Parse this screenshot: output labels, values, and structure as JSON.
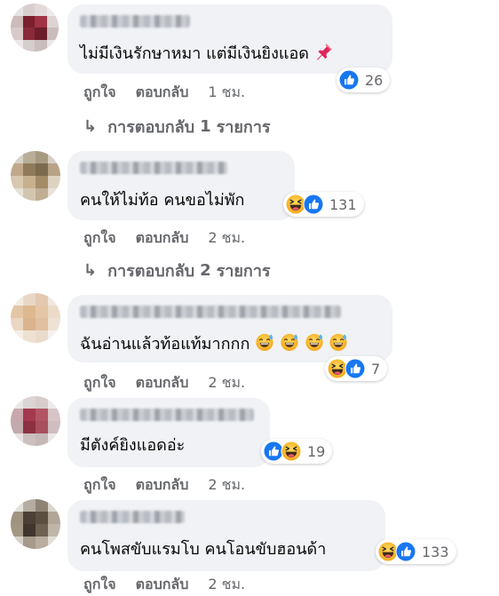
{
  "comments": [
    {
      "text": "ไม่มีเงินรักษาหมา แต่มีเงินยิงแอด",
      "emoji": "pushpin",
      "reactions": [
        "like"
      ],
      "count": "26",
      "like_label": "ถูกใจ",
      "reply_label": "ตอบกลับ",
      "time": "1 ชม.",
      "replies": {
        "prefix": "การตอบกลับ",
        "number": "1",
        "suffix": "รายการ"
      }
    },
    {
      "text": "คนให้ไม่ท้อ คนขอไม่พัก",
      "reactions": [
        "haha",
        "like"
      ],
      "count": "131",
      "like_label": "ถูกใจ",
      "reply_label": "ตอบกลับ",
      "time": "2 ชม.",
      "replies": {
        "prefix": "การตอบกลับ",
        "number": "2",
        "suffix": "รายการ"
      }
    },
    {
      "text": "ฉันอ่านแล้วท้อแท้มากกก",
      "emoji": "laughing-sweat-x4",
      "reactions": [
        "haha",
        "like"
      ],
      "count": "7",
      "like_label": "ถูกใจ",
      "reply_label": "ตอบกลับ",
      "time": "2 ชม."
    },
    {
      "text": "มีตังค์ยิงแอดอ่ะ",
      "reactions": [
        "like",
        "haha"
      ],
      "count": "19",
      "like_label": "ถูกใจ",
      "reply_label": "ตอบกลับ",
      "time": "2 ชม."
    },
    {
      "text": "คนโพสขับแรมโบ คนโอนขับฮอนด้า",
      "reactions": [
        "haha",
        "like"
      ],
      "count": "133",
      "like_label": "ถูกใจ",
      "reply_label": "ตอบกลับ",
      "time": "2 ชม."
    }
  ],
  "colors": {
    "like_blue": "#1877f2",
    "haha_yellow": "#f7b125",
    "bubble_bg": "#f0f2f5",
    "meta_gray": "#65676b"
  }
}
